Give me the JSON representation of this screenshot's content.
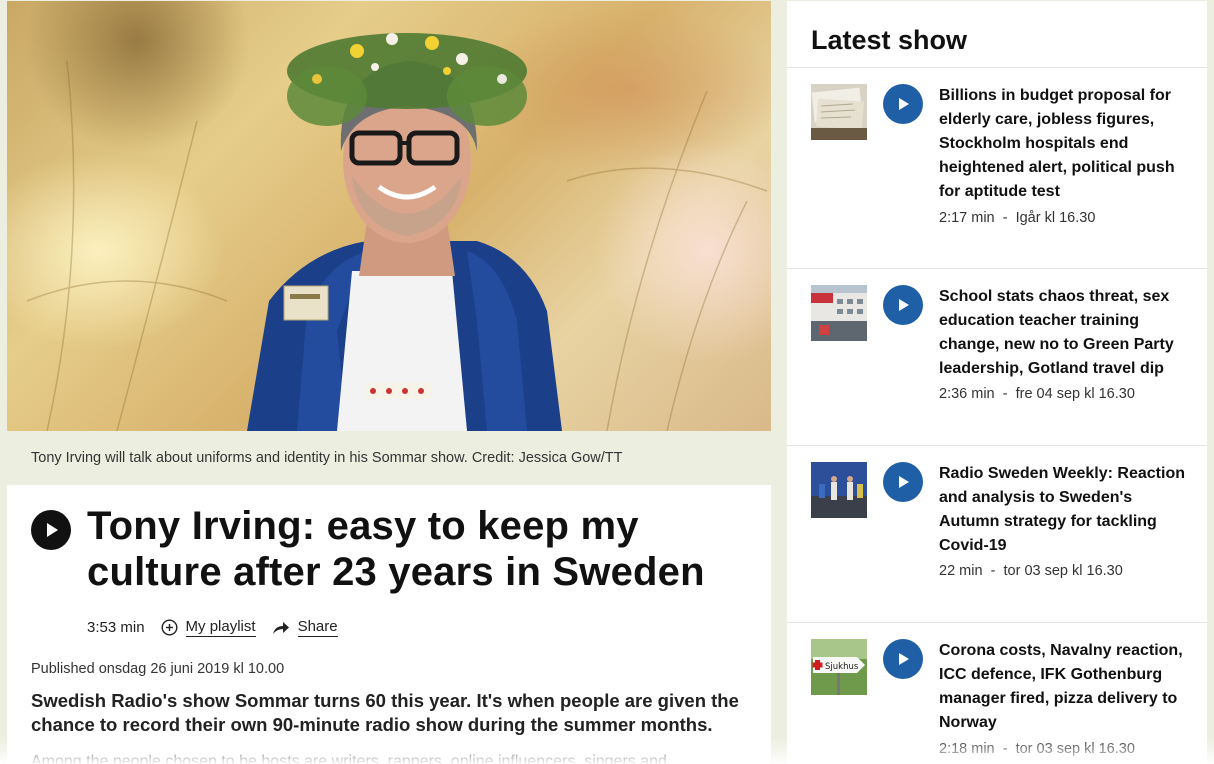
{
  "article": {
    "image_caption": "Tony Irving will talk about uniforms and identity in his Sommar show. Credit: Jessica Gow/TT",
    "title": "Tony Irving: easy to keep my culture after 23 years in Sweden",
    "duration": "3:53 min",
    "playlist_label": "My playlist",
    "share_label": "Share",
    "published": "Published onsdag 26 juni 2019 kl 10.00",
    "lead": "Swedish Radio's show Sommar turns 60 this year. It's when people are given the chance to record their own 90-minute radio show during the summer months.",
    "body_partial": "Among the people chosen to be hosts are writers, rappers, online influencers, singers and"
  },
  "sidebar": {
    "heading": "Latest show",
    "shows": [
      {
        "title": "Billions in budget proposal for elderly care, jobless figures, Stockholm hospitals end heightened alert, political push for aptitude test",
        "duration": "2:17 min",
        "separator": "-",
        "date": "Igår kl 16.30"
      },
      {
        "title": "School stats chaos threat, sex education teacher training change, new no to Green Party leadership, Gotland travel dip",
        "duration": "2:36 min",
        "separator": "-",
        "date": "fre 04 sep kl 16.30"
      },
      {
        "title": "Radio Sweden Weekly: Reaction and analysis to Sweden's Autumn strategy for tackling Covid-19",
        "duration": "22 min",
        "separator": "-",
        "date": "tor 03 sep kl 16.30"
      },
      {
        "title": "Corona costs, Navalny reaction, ICC defence, IFK Gothenburg manager fired, pizza delivery to Norway",
        "duration": "2:18 min",
        "separator": "-",
        "date": "tor 03 sep kl 16.30",
        "thumb_sign_text": "Sjukhus"
      }
    ]
  },
  "colors": {
    "page_background": "#ecefe0",
    "play_button_primary": "#111111",
    "play_button_sidebar": "#1f5fa6"
  },
  "icons": {
    "main_play": "play-icon",
    "playlist": "plus-circle-icon",
    "share": "share-arrow-icon",
    "sidebar_play": "play-icon"
  }
}
